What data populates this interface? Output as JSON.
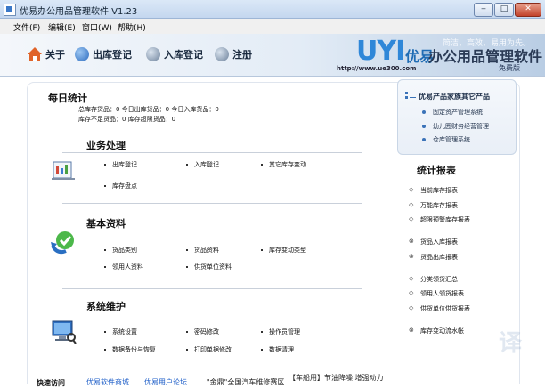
{
  "window": {
    "title": "优易办公用品管理软件 V1.23",
    "min": "‒",
    "max": "□",
    "close": "✕"
  },
  "menu": [
    "文件(F)",
    "编辑(E)",
    "窗口(W)",
    "帮助(H)"
  ],
  "toolbar": [
    {
      "label": "关于",
      "icon": "home-icon"
    },
    {
      "label": "出库登记",
      "icon": "outbound-icon"
    },
    {
      "label": "入库登记",
      "icon": "inbound-icon"
    },
    {
      "label": "注册",
      "icon": "register-icon"
    }
  ],
  "brand": {
    "mark": "UYI",
    "cn": "优易",
    "name": "办公用品管理软件",
    "url": "http://www.ue300.com",
    "slogan": "简洁、高效、易用为先。",
    "edition": "免费版"
  },
  "daily": {
    "title": "每日统计",
    "row1": "总库存货品：0  今日出库货品：0  今日入库货品：0",
    "row2": "库存不足货品：0  库存超限货品：0"
  },
  "sections": [
    {
      "title": "业务处理",
      "icon": "business-icon",
      "links": [
        "出库登记",
        "入库登记",
        "其它库存变动",
        "库存盘点"
      ]
    },
    {
      "title": "基本资料",
      "icon": "basic-data-icon",
      "links": [
        "货品类别",
        "货品资料",
        "库存变动类型",
        "领用人资料",
        "供货单位资料"
      ]
    },
    {
      "title": "系统维护",
      "icon": "maintenance-icon",
      "links": [
        "系统设置",
        "密码修改",
        "操作员管理",
        "数据备份与恢复",
        "打印单据修改",
        "数据清理"
      ]
    }
  ],
  "family": {
    "title": "优易产品家族其它产品",
    "items": [
      "固定资产管理系统",
      "幼儿园财务经营管理",
      "仓库管理系统"
    ]
  },
  "reports": {
    "title": "统计报表",
    "items": [
      "当前库存报表",
      "万能库存报表",
      "超限预警库存报表",
      "货品入库报表",
      "货品出库报表",
      "分类领货汇总",
      "领用人领货报表",
      "供货单位供货报表",
      "库存变动流水帐"
    ]
  },
  "footer": {
    "label": "快速访问",
    "links": [
      "优易软件商城",
      "优易用户论坛",
      "\"金鼎\"全国汽车维修赛区",
      "【车船用】节油降噪 增强动力"
    ]
  },
  "colors": {
    "accent": "#2f87d8",
    "link": "#1f5fc8",
    "promo": "#c0282a"
  }
}
